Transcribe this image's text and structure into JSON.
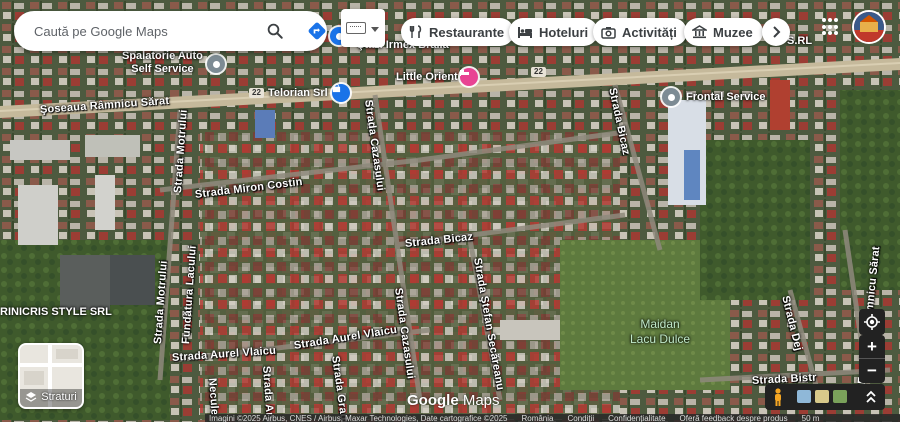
{
  "search": {
    "placeholder": "Caută pe Google Maps"
  },
  "chips": [
    {
      "label": "Restaurante",
      "icon": "restaurant-icon"
    },
    {
      "label": "Hoteluri",
      "icon": "hotel-icon"
    },
    {
      "label": "Activități",
      "icon": "camera-icon"
    },
    {
      "label": "Muzee",
      "icon": "museum-icon"
    }
  ],
  "places": {
    "spalatorie": "Spalatorie Auto\nSelf Service",
    "little_orient": "Little Orient",
    "telorian": "Telorian Srl",
    "frontal": "Frontal Service",
    "rinicris": "RINICRIS STYLE SRL",
    "maidan": "Maidan\nLacu Dulce",
    "irmex_partial": "Ştazi Irmex Braila",
    "srl_partial": "S.RL"
  },
  "streets": {
    "ramnicu": "Şoseaua Râmnicu Sărat",
    "motrului_1": "Strada Motrului",
    "motrului_2": "Strada Motrului",
    "miron": "Strada Miron Costin",
    "cazasului_1": "Strada Cazasului",
    "cazasului_2": "Strada Cazasului",
    "bicaz_1": "Strada Bicaz",
    "bicaz_2": "Strada Bicaz",
    "stefan": "Strada Ştefan Secăreanu",
    "aurel_1": "Strada Aurel Vlaicu",
    "aurel_2": "Strada Aurel Vlaicu",
    "fundatura": "Fundătura Lacului",
    "fundatura_rs": "Fundătura Râmnicu Sărat",
    "dej": "Strada Dej",
    "gradi": "Strada Gradi",
    "arad": "Strada Arad",
    "necule": "Necule",
    "bistr": "Strada Bistr"
  },
  "road_numbers": [
    "22",
    "22"
  ],
  "layers": {
    "label": "Straturi"
  },
  "logo": {
    "google": "Google",
    "maps": "Maps"
  },
  "attribution": {
    "imagery": "Imagini ©2025 Airbus, CNES / Airbus, Maxar Technologies, Date cartografice ©2025",
    "country": "România",
    "terms": "Condiții",
    "privacy": "Confidențialitate",
    "feedback": "Oferă feedback despre produs",
    "scale": "50 m"
  },
  "colors": {
    "accent_pin": "#1a73e8",
    "hotel_pin": "#e84393",
    "generic_pin": "#7d8b94"
  }
}
